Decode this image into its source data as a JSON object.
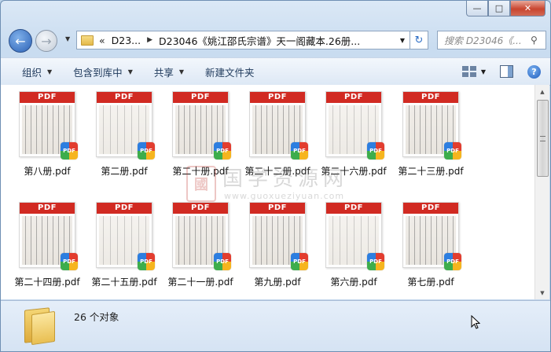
{
  "window": {
    "caption_buttons": {
      "minimize": "—",
      "maximize": "□",
      "close": "✕"
    }
  },
  "address_bar": {
    "overflow": "«",
    "crumbs": [
      "D23...",
      "D23046《姚江邵氏宗谱》天一阁藏本.26册..."
    ],
    "folder_icon": "folder-icon"
  },
  "search": {
    "placeholder": "搜索 D23046《..."
  },
  "toolbar": {
    "organize": "组织",
    "include_in_library": "包含到库中",
    "share": "共享",
    "new_folder": "新建文件夹"
  },
  "files": [
    {
      "name": "第八册.pdf",
      "band": "PDF",
      "badge": "PDF"
    },
    {
      "name": "第二册.pdf",
      "band": "PDF",
      "badge": "PDF"
    },
    {
      "name": "第二十册.pdf",
      "band": "PDF",
      "badge": "PDF"
    },
    {
      "name": "第二十二册.pdf",
      "band": "PDF",
      "badge": "PDF"
    },
    {
      "name": "第二十六册.pdf",
      "band": "PDF",
      "badge": "PDF"
    },
    {
      "name": "第二十三册.pdf",
      "band": "PDF",
      "badge": "PDF"
    },
    {
      "name": "第二十四册.pdf",
      "band": "PDF",
      "badge": "PDF"
    },
    {
      "name": "第二十五册.pdf",
      "band": "PDF",
      "badge": "PDF"
    },
    {
      "name": "第二十一册.pdf",
      "band": "PDF",
      "badge": "PDF"
    },
    {
      "name": "第九册.pdf",
      "band": "PDF",
      "badge": "PDF"
    },
    {
      "name": "第六册.pdf",
      "band": "PDF",
      "badge": "PDF"
    },
    {
      "name": "第七册.pdf",
      "band": "PDF",
      "badge": "PDF"
    }
  ],
  "watermark": {
    "seal": "國",
    "title": "国学资源网",
    "url": "www.guoxueziyuan.com"
  },
  "status": {
    "count": "26 个对象"
  },
  "colors": {
    "pdf_band": "#d12a22",
    "accent": "#2c62b6"
  }
}
